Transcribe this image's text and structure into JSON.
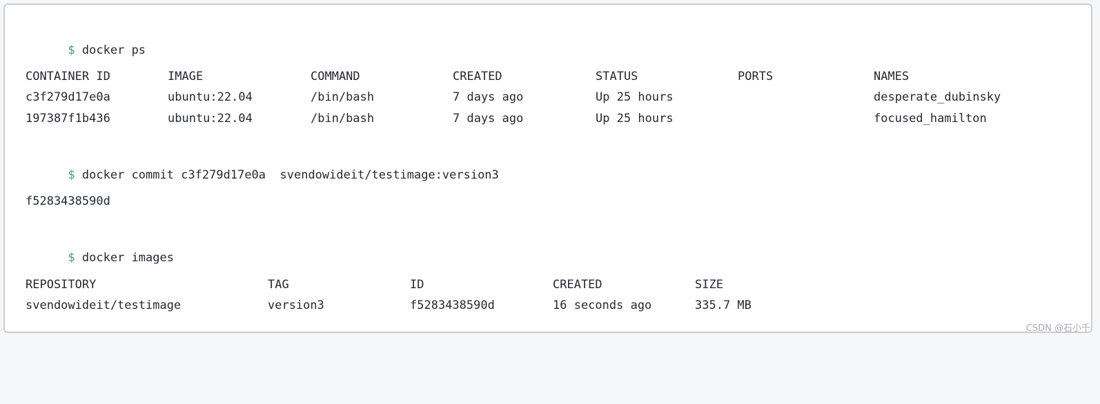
{
  "prompt_symbol": "$",
  "commands": {
    "ps": "docker ps",
    "commit": "docker commit c3f279d17e0a  svendowideit/testimage:version3",
    "images": "docker images"
  },
  "ps_table": {
    "headers": [
      "CONTAINER ID",
      "IMAGE",
      "COMMAND",
      "CREATED",
      "STATUS",
      "PORTS",
      "NAMES"
    ],
    "rows": [
      [
        "c3f279d17e0a",
        "ubuntu:22.04",
        "/bin/bash",
        "7 days ago",
        "Up 25 hours",
        "",
        "desperate_dubinsky"
      ],
      [
        "197387f1b436",
        "ubuntu:22.04",
        "/bin/bash",
        "7 days ago",
        "Up 25 hours",
        "",
        "focused_hamilton"
      ]
    ]
  },
  "commit_output": "f5283438590d",
  "images_table": {
    "headers": [
      "REPOSITORY",
      "TAG",
      "ID",
      "CREATED",
      "SIZE"
    ],
    "rows": [
      [
        "svendowideit/testimage",
        "version3",
        "f5283438590d",
        "16 seconds ago",
        "335.7 MB"
      ]
    ]
  },
  "watermark": "CSDN @石小千",
  "colors": {
    "prompt": "#3f9c7f",
    "text": "#24292f",
    "border": "#c9ccd1"
  }
}
